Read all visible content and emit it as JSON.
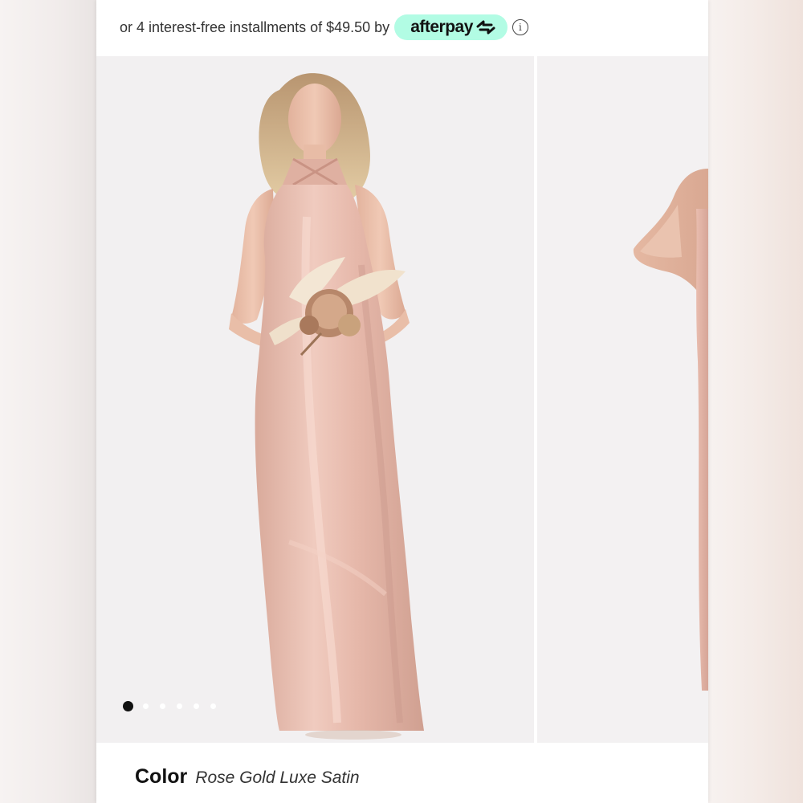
{
  "afterpay": {
    "text": "or 4 interest-free installments of $49.50 by",
    "brand": "afterpay",
    "badge_color": "#b2fce4",
    "info_icon": "info-icon"
  },
  "gallery": {
    "slides": [
      "product-photo-front",
      "product-photo-side"
    ],
    "dots_total": 6,
    "active_dot": 1
  },
  "product": {
    "color_label": "Color",
    "color_value": "Rose Gold Luxe Satin"
  }
}
